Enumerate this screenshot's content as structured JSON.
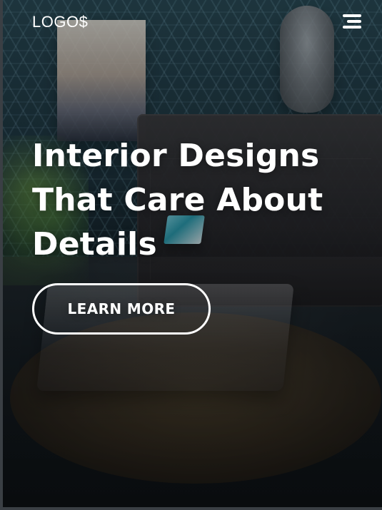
{
  "header": {
    "logo_text": "LOGO$",
    "menu_icon": "hamburger-menu-icon"
  },
  "hero": {
    "title_line_1": "Interior Designs",
    "title_line_2": "That Care About",
    "title_line_3": "Details",
    "cta_label": "LEARN MORE"
  },
  "colors": {
    "text": "#ffffff",
    "overlay": "#000000"
  }
}
